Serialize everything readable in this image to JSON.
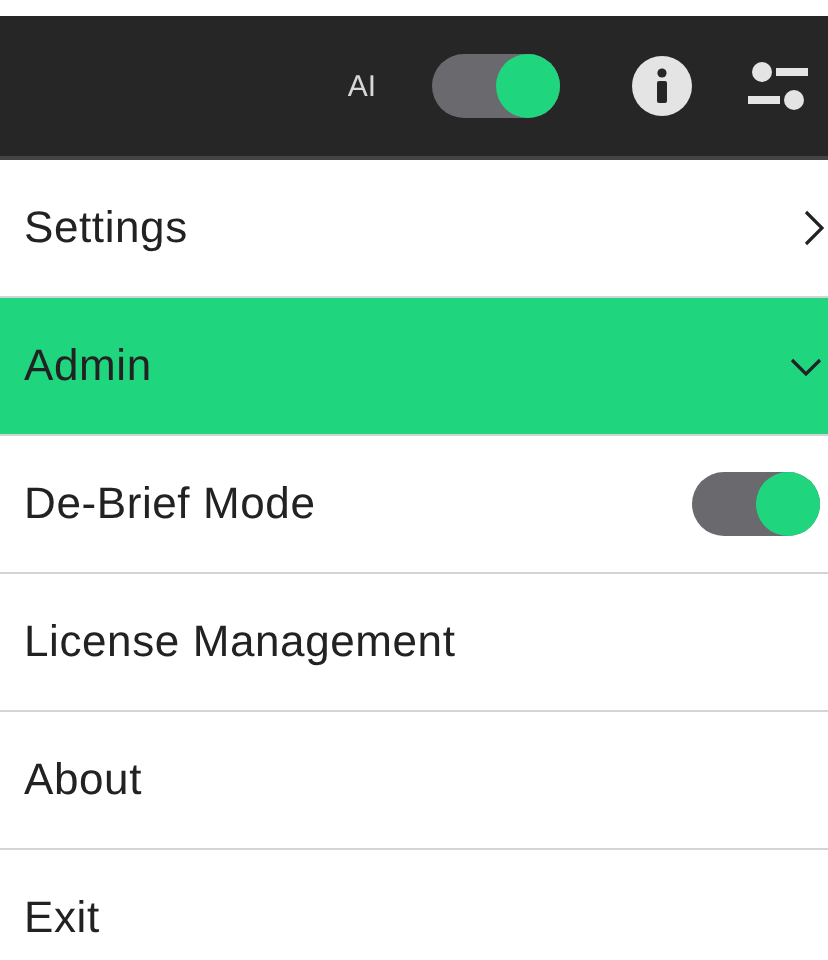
{
  "top_bar": {
    "ai_label": "AI",
    "ai_toggle": {
      "on": true
    }
  },
  "menu": [
    {
      "label": "Settings",
      "kind": "submenu",
      "expanded": false,
      "selected": false
    },
    {
      "label": "Admin",
      "kind": "submenu",
      "expanded": true,
      "selected": true
    },
    {
      "label": "De-Brief Mode",
      "kind": "toggle",
      "on": true,
      "selected": false
    },
    {
      "label": "License Management",
      "kind": "plain",
      "selected": false
    },
    {
      "label": "About",
      "kind": "plain",
      "selected": false
    },
    {
      "label": "Exit",
      "kind": "plain",
      "selected": false
    }
  ]
}
